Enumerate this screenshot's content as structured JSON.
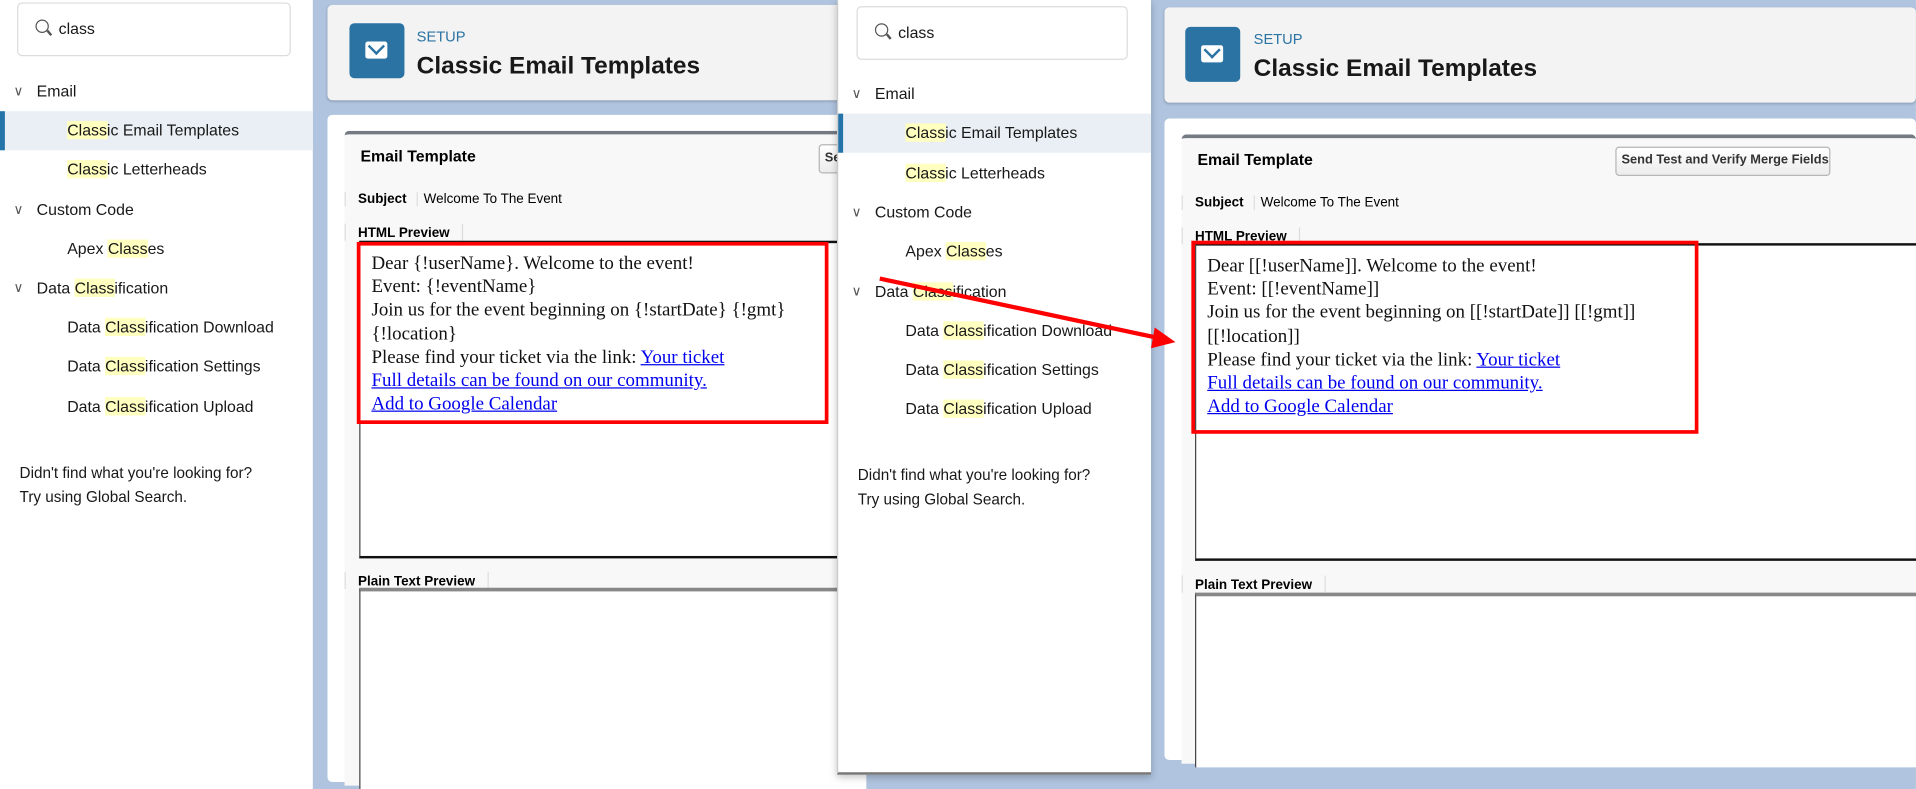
{
  "search": {
    "value": "class"
  },
  "sidebar": {
    "groups": [
      {
        "label_pre": "Email",
        "label_hl": "",
        "label_post": "",
        "items": [
          {
            "pre": "",
            "hl": "Class",
            "post": "ic Email Templates",
            "selected": true
          },
          {
            "pre": "",
            "hl": "Class",
            "post": "ic Letterheads"
          }
        ]
      },
      {
        "label_pre": "Custom Code",
        "label_hl": "",
        "label_post": "",
        "items": [
          {
            "pre": "Apex ",
            "hl": "Class",
            "post": "es"
          }
        ]
      },
      {
        "label_pre": "Data ",
        "label_hl": "Class",
        "label_post": "ification",
        "items": [
          {
            "pre": "Data ",
            "hl": "Class",
            "post": "ification Download"
          },
          {
            "pre": "Data ",
            "hl": "Class",
            "post": "ification Settings"
          },
          {
            "pre": "Data ",
            "hl": "Class",
            "post": "ification Upload"
          }
        ]
      }
    ],
    "help_line1": "Didn't find what you're looking for?",
    "help_line2": "Try using Global Search."
  },
  "header": {
    "eyebrow": "SETUP",
    "title": "Classic Email Templates",
    "icon": "envelope-icon"
  },
  "template": {
    "section_title": "Email Template",
    "send_test_button": "Send Test and Verify Merge Fields",
    "send_test_button_truncated": "Se",
    "subject_label": "Subject",
    "subject_value": "Welcome To The Event",
    "html_preview_tab": "HTML Preview",
    "plain_text_preview_tab": "Plain Text Preview"
  },
  "preview_before": {
    "line1": "Dear {!userName}. Welcome to the event!",
    "line2": "Event: {!eventName}",
    "line3": "Join us for the event beginning on {!startDate} {!gmt}",
    "line4": "{!location}",
    "line5": "Please find your ticket via the link: ",
    "link_ticket": "Your ticket",
    "link_details": "Full details can be found on our community.",
    "link_calendar": "Add to Google Calendar"
  },
  "preview_after": {
    "line1": "Dear [[!userName]]. Welcome to the event!",
    "line2": "Event: [[!eventName]]",
    "line3": "Join us for the event beginning on [[!startDate]] [[!gmt]]",
    "line4": "[[!location]]",
    "line5": "Please find your ticket via the link: ",
    "link_ticket": "Your ticket",
    "link_details": "Full details can be found on our community.",
    "link_calendar": "Add to Google Calendar"
  },
  "colors": {
    "accent": "#2a73a3",
    "highlight": "#ffffbf",
    "annotation": "#ff0000",
    "background": "#b0c4df"
  }
}
